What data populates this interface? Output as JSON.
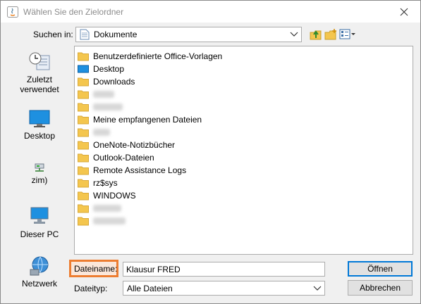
{
  "window": {
    "title": "Wählen Sie den Zielordner"
  },
  "lookin": {
    "label": "Suchen in:",
    "value": "Dokumente"
  },
  "places": [
    {
      "label": "Zuletzt verwendet"
    },
    {
      "label": "Desktop"
    },
    {
      "label": "zim)"
    },
    {
      "label": "Dieser PC"
    },
    {
      "label": "Netzwerk"
    }
  ],
  "files": [
    {
      "name": "Benutzerdefinierte Office-Vorlagen",
      "icon": "folder-icon"
    },
    {
      "name": "Desktop",
      "icon": "desktop-folder-icon"
    },
    {
      "name": "Downloads",
      "icon": "folder-icon"
    },
    {
      "name": "",
      "icon": "folder-icon",
      "blurred": true
    },
    {
      "name": "",
      "icon": "folder-icon",
      "blurred": true
    },
    {
      "name": "Meine empfangenen Dateien",
      "icon": "folder-icon"
    },
    {
      "name": "",
      "icon": "folder-icon",
      "blurred": true
    },
    {
      "name": "OneNote-Notizbücher",
      "icon": "folder-icon"
    },
    {
      "name": "Outlook-Dateien",
      "icon": "folder-icon"
    },
    {
      "name": "Remote Assistance Logs",
      "icon": "folder-icon"
    },
    {
      "name": "rz$sys",
      "icon": "folder-icon"
    },
    {
      "name": "WINDOWS",
      "icon": "folder-icon"
    },
    {
      "name": "",
      "icon": "folder-icon",
      "blurred": true
    },
    {
      "name": "",
      "icon": "folder-icon",
      "blurred": true
    }
  ],
  "filename": {
    "label": "Dateiname:",
    "value": "Klausur FRED"
  },
  "filetype": {
    "label": "Dateityp:",
    "value": "Alle Dateien"
  },
  "buttons": {
    "open": "Öffnen",
    "cancel": "Abbrechen"
  },
  "colors": {
    "highlight": "#ed7d31",
    "folder": "#f4c64e",
    "accent": "#0078d7"
  }
}
